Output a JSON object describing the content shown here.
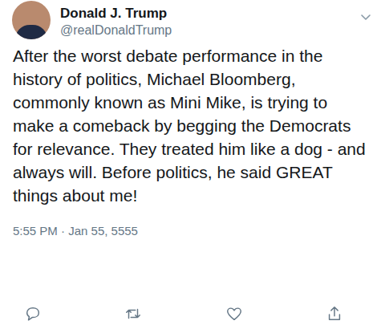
{
  "tweet": {
    "author": {
      "name": "Donald J. Trump",
      "handle": "@realDonaldTrump"
    },
    "text": "After the worst debate performance in the history of politics, Michael Bloomberg, commonly known as Mini Mike, is trying to make a comeback by begging the Democrats for relevance. They treated him like a dog - and always will. Before politics, he said GREAT things about me!",
    "timestamp": "5:55 PM · Jan 55, 5555"
  }
}
